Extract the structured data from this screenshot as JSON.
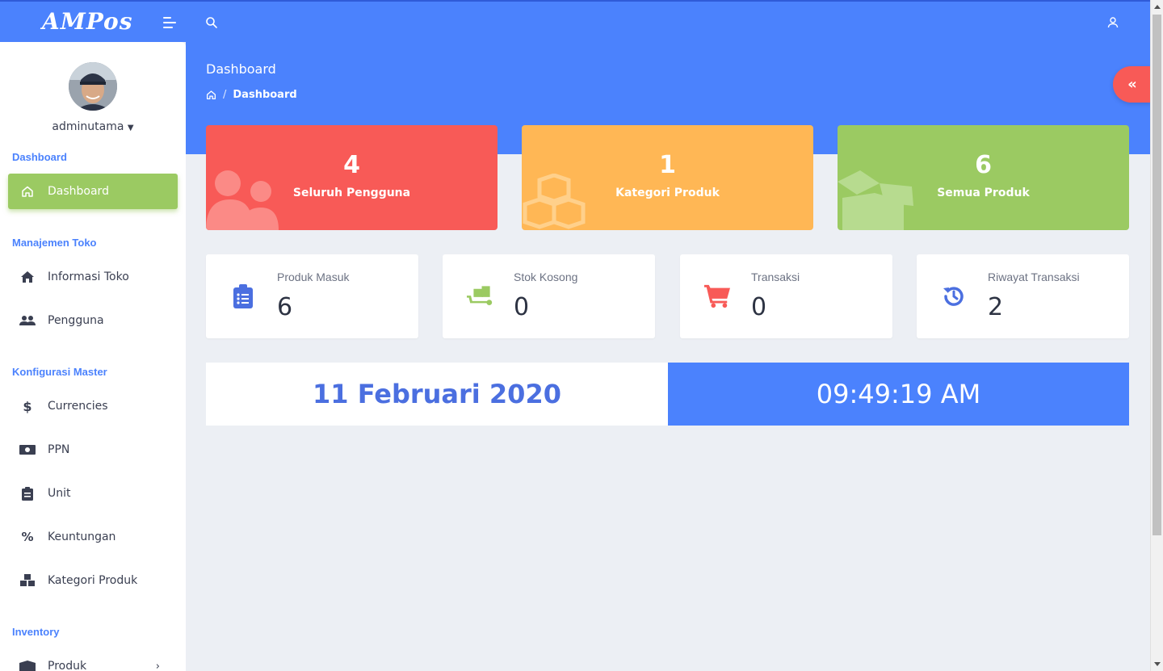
{
  "app": {
    "logo_text": "AMPos"
  },
  "colors": {
    "primary": "#4b82fd",
    "red": "#f85a57",
    "orange": "#ffb755",
    "green": "#9bca62"
  },
  "user": {
    "name": "adminutama"
  },
  "sidebar": {
    "sections": [
      {
        "title": "Dashboard"
      },
      {
        "title": "Manajemen Toko"
      },
      {
        "title": "Konfigurasi Master"
      },
      {
        "title": "Inventory"
      }
    ],
    "items": [
      {
        "label": "Dashboard",
        "icon": "home-outline-icon",
        "active": true
      },
      {
        "label": "Informasi Toko",
        "icon": "home-icon"
      },
      {
        "label": "Pengguna",
        "icon": "users-icon"
      },
      {
        "label": "Currencies",
        "icon": "dollar-icon"
      },
      {
        "label": "PPN",
        "icon": "money-bill-icon"
      },
      {
        "label": "Unit",
        "icon": "clipboard-icon"
      },
      {
        "label": "Keuntungan",
        "icon": "percent-icon"
      },
      {
        "label": "Kategori Produk",
        "icon": "cubes-icon"
      },
      {
        "label": "Produk",
        "icon": "box-icon"
      }
    ]
  },
  "header": {
    "title": "Dashboard",
    "breadcrumb": [
      "Dashboard"
    ]
  },
  "cards": [
    {
      "value": "4",
      "label": "Seluruh Pengguna",
      "color": "#f85a57",
      "icon": "users-icon"
    },
    {
      "value": "1",
      "label": "Kategori Produk",
      "color": "#ffb755",
      "icon": "cubes-icon"
    },
    {
      "value": "6",
      "label": "Semua Produk",
      "color": "#9bca62",
      "icon": "box-open-icon"
    }
  ],
  "stats": [
    {
      "title": "Produk Masuk",
      "value": "6",
      "icon": "clipboard-list-icon",
      "color": "#4b6fe0"
    },
    {
      "title": "Stok Kosong",
      "value": "0",
      "icon": "dolly-icon",
      "color": "#9bca62"
    },
    {
      "title": "Transaksi",
      "value": "0",
      "icon": "cart-icon",
      "color": "#f85a57"
    },
    {
      "title": "Riwayat Transaksi",
      "value": "2",
      "icon": "history-icon",
      "color": "#4b6fe0"
    }
  ],
  "datetime": {
    "date": "11 Februari 2020",
    "time": "09:49:19 AM"
  }
}
